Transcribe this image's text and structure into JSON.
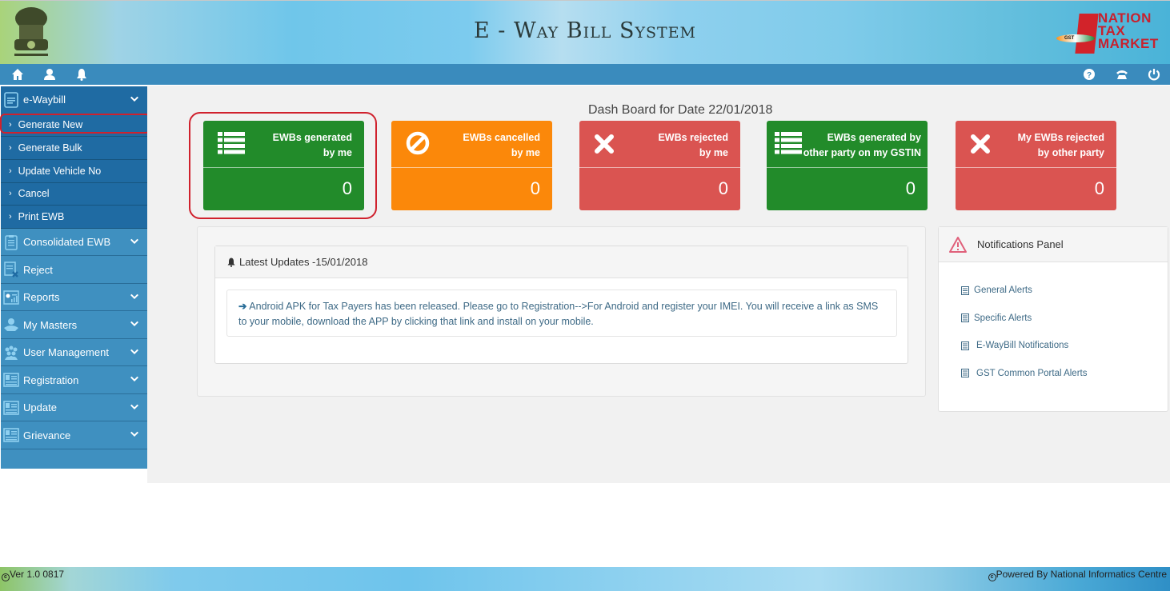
{
  "header": {
    "title": "E - Way Bill System",
    "emblem_icon": "national-emblem-icon",
    "brand": {
      "lines": [
        "NATION",
        "TAX",
        "MARKET"
      ],
      "badge": "GST"
    }
  },
  "navbar": {
    "left_icons": [
      "home-icon",
      "user-icon",
      "bell-icon"
    ],
    "right_icons": [
      "help-icon",
      "phone-icon",
      "power-icon"
    ]
  },
  "sidebar": {
    "items": [
      {
        "label": "e-Waybill",
        "icon": "document-icon",
        "expandable": true,
        "expanded": true,
        "children": [
          {
            "label": "Generate New",
            "highlighted": true
          },
          {
            "label": "Generate Bulk"
          },
          {
            "label": "Update Vehicle No"
          },
          {
            "label": "Cancel"
          },
          {
            "label": "Print EWB"
          }
        ]
      },
      {
        "label": "Consolidated EWB",
        "icon": "clipboard-icon",
        "expandable": true
      },
      {
        "label": "Reject",
        "icon": "reject-document-icon",
        "expandable": false
      },
      {
        "label": "Reports",
        "icon": "report-icon",
        "expandable": true
      },
      {
        "label": "My Masters",
        "icon": "masters-icon",
        "expandable": true
      },
      {
        "label": "User Management",
        "icon": "users-icon",
        "expandable": true
      },
      {
        "label": "Registration",
        "icon": "id-card-icon",
        "expandable": true
      },
      {
        "label": "Update",
        "icon": "id-card-icon",
        "expandable": true
      },
      {
        "label": "Grievance",
        "icon": "id-card-icon",
        "expandable": true
      }
    ]
  },
  "dashboard": {
    "title": "Dash Board for Date 22/01/2018",
    "tiles": [
      {
        "line1": "EWBs generated",
        "line2": "by me",
        "value": "0",
        "icon": "list-icon",
        "color": "#228b2a",
        "highlighted": true
      },
      {
        "line1": "EWBs cancelled",
        "line2": "by me",
        "value": "0",
        "icon": "ban-icon",
        "color": "#fb880a"
      },
      {
        "line1": "EWBs rejected",
        "line2": "by me",
        "value": "0",
        "icon": "close-icon",
        "color": "#da5451"
      },
      {
        "line1": "EWBs generated by",
        "line2": "other party on my GSTIN",
        "value": "0",
        "icon": "list-icon",
        "color": "#228b2a"
      },
      {
        "line1": "My EWBs rejected",
        "line2": "by other party",
        "value": "0",
        "icon": "close-icon",
        "color": "#da5451"
      }
    ]
  },
  "updates": {
    "heading": "Latest Updates -15/01/2018",
    "message": "Android APK for Tax Payers has been released. Please go to Registration-->For Android and register your IMEI. You will receive a link as SMS to your mobile, download the APP by clicking that link and install on your mobile."
  },
  "notifications": {
    "heading": "Notifications Panel",
    "items": [
      "General Alerts",
      "Specific Alerts",
      "E-WayBill Notifications",
      "GST Common Portal Alerts"
    ]
  },
  "footer": {
    "version": "Ver 1.0 0817",
    "powered_by": "Powered By National Informatics Centre"
  },
  "colors": {
    "accent_blue": "#3a8bbd",
    "sidebar_dark": "#1f6ba3",
    "highlight_red": "#d0212d",
    "green": "#228b2a",
    "orange": "#fb880a",
    "red": "#da5451"
  }
}
